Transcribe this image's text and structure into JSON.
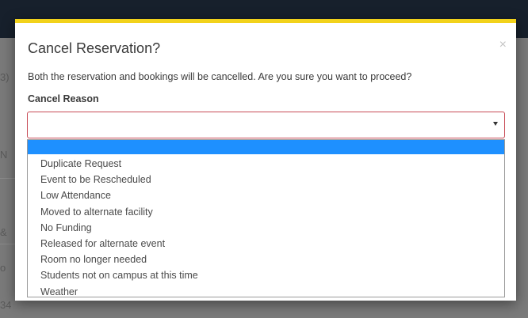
{
  "modal": {
    "title": "Cancel Reservation?",
    "message": "Both the reservation and bookings will be cancelled. Are you sure you want to proceed?",
    "close_label": "×",
    "accent_color": "#f2d21b"
  },
  "cancel_reason": {
    "label": "Cancel Reason",
    "selected_value": "",
    "options": [
      "Duplicate Request",
      "Event to be Rescheduled",
      "Low Attendance",
      "Moved to alternate facility",
      "No Funding",
      "Released for alternate event",
      "Room no longer needed",
      "Students not on campus at this time",
      "Weather"
    ]
  },
  "background_fragments": [
    "3)",
    "N",
    "&",
    "o",
    "34"
  ]
}
